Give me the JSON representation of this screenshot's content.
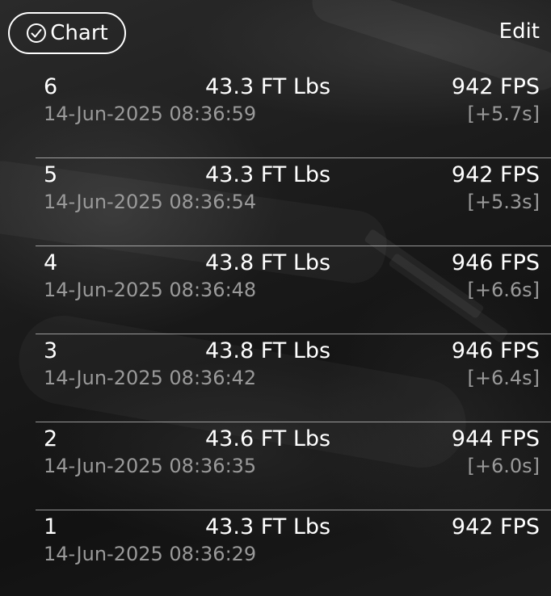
{
  "header": {
    "chart_label": "Chart",
    "edit_label": "Edit"
  },
  "shots": [
    {
      "number": "6",
      "energy": "43.3 FT Lbs",
      "velocity": "942 FPS",
      "timestamp": "14-Jun-2025 08:36:59",
      "delta": "[+5.7s]"
    },
    {
      "number": "5",
      "energy": "43.3 FT Lbs",
      "velocity": "942 FPS",
      "timestamp": "14-Jun-2025 08:36:54",
      "delta": "[+5.3s]"
    },
    {
      "number": "4",
      "energy": "43.8 FT Lbs",
      "velocity": "946 FPS",
      "timestamp": "14-Jun-2025 08:36:48",
      "delta": "[+6.6s]"
    },
    {
      "number": "3",
      "energy": "43.8 FT Lbs",
      "velocity": "946 FPS",
      "timestamp": "14-Jun-2025 08:36:42",
      "delta": "[+6.4s]"
    },
    {
      "number": "2",
      "energy": "43.6 FT Lbs",
      "velocity": "944 FPS",
      "timestamp": "14-Jun-2025 08:36:35",
      "delta": "[+6.0s]"
    },
    {
      "number": "1",
      "energy": "43.3 FT Lbs",
      "velocity": "942 FPS",
      "timestamp": "14-Jun-2025 08:36:29",
      "delta": ""
    }
  ]
}
